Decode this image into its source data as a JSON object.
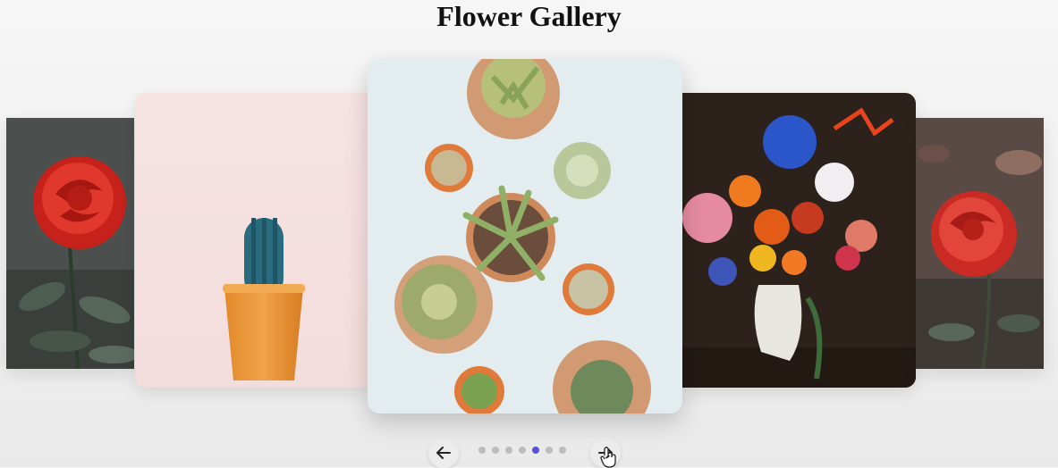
{
  "page": {
    "title": "Flower Gallery"
  },
  "gallery": {
    "slides": [
      {
        "id": "red-rose-left",
        "alt": ""
      },
      {
        "id": "cactus-pot",
        "alt": ""
      },
      {
        "id": "succulents-topview",
        "alt": ""
      },
      {
        "id": "flower-bouquet-vase",
        "alt": ""
      },
      {
        "id": "red-rose-right",
        "alt": ""
      }
    ],
    "dot_count": 7,
    "active_dot_index": 4
  },
  "controls": {
    "prev_icon": "arrow-left-icon",
    "next_icon": "arrow-right-icon"
  },
  "colors": {
    "accent": "#5a4fd8",
    "dot_inactive": "#bdbdbd",
    "button_bg": "#ececec"
  }
}
